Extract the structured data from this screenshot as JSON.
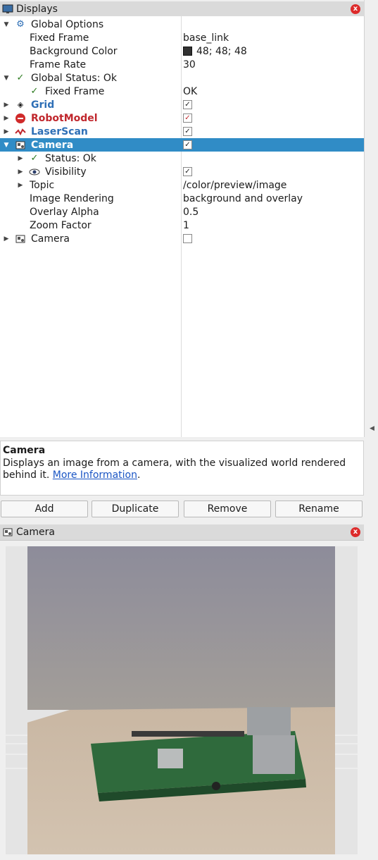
{
  "displays_panel": {
    "title": "Displays",
    "close": "x",
    "rows": [
      {
        "label": "Global Options",
        "value": ""
      },
      {
        "label": "Fixed Frame",
        "value": "base_link"
      },
      {
        "label": "Background Color",
        "value": "48; 48; 48"
      },
      {
        "label": "Frame Rate",
        "value": "30"
      },
      {
        "label": "Global Status: Ok",
        "value": ""
      },
      {
        "label": "Fixed Frame",
        "value": "OK"
      },
      {
        "label": "Grid",
        "checked": true
      },
      {
        "label": "RobotModel",
        "checked": true
      },
      {
        "label": "LaserScan",
        "checked": true
      },
      {
        "label": "Camera",
        "checked": true,
        "selected": true
      },
      {
        "label": "Status: Ok",
        "value": ""
      },
      {
        "label": "Visibility",
        "checked": true
      },
      {
        "label": "Topic",
        "value": "/color/preview/image"
      },
      {
        "label": "Image Rendering",
        "value": "background and overlay"
      },
      {
        "label": "Overlay Alpha",
        "value": "0.5"
      },
      {
        "label": "Zoom Factor",
        "value": "1"
      },
      {
        "label": "Camera",
        "checked": false
      }
    ]
  },
  "description": {
    "title": "Camera",
    "text": "Displays an image from a camera, with the visualized world rendered behind it.",
    "link": "More Information",
    "after": "."
  },
  "buttons": {
    "add": "Add",
    "duplicate": "Duplicate",
    "remove": "Remove",
    "rename": "Rename"
  },
  "camera_panel": {
    "title": "Camera",
    "close": "x"
  },
  "colors": {
    "selection": "#308cc6",
    "link": "#1a55c4",
    "status_ok": "#2b7a1e",
    "error": "#c0272d"
  }
}
